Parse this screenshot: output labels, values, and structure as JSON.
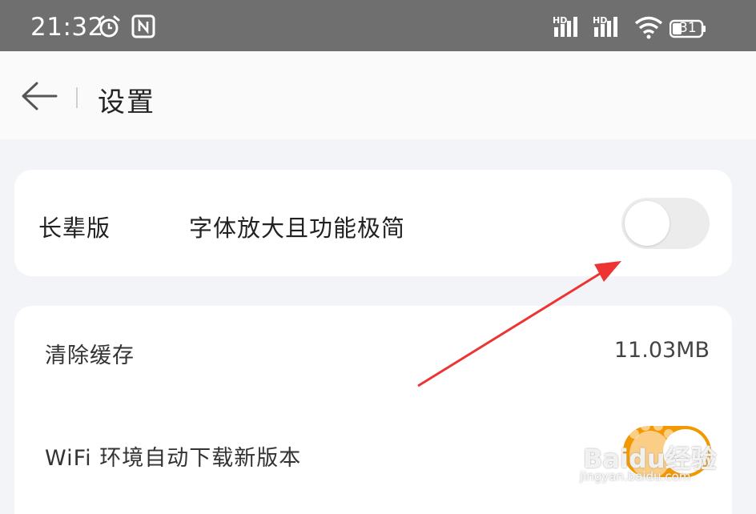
{
  "status_bar": {
    "time": "21:32",
    "battery": "31",
    "icons": [
      "alarm-icon",
      "nfc-icon",
      "hd-signal-icon",
      "hd-signal-icon",
      "wifi-icon",
      "battery-icon"
    ]
  },
  "header": {
    "title": "设置",
    "back_icon": "arrow-left-icon"
  },
  "settings": {
    "elder_mode": {
      "label": "长辈版",
      "description": "字体放大且功能极简",
      "enabled": false
    },
    "clear_cache": {
      "label": "清除缓存",
      "value": "11.03MB"
    },
    "wifi_auto_download": {
      "label": "WiFi 环境自动下载新版本",
      "enabled": true
    }
  },
  "annotation": {
    "color": "#ee3333"
  },
  "watermark": {
    "main": "Baidu经验",
    "sub": "jingyan.baidu.com"
  },
  "colors": {
    "toggle_on": "#f39800",
    "toggle_off": "#ececec"
  }
}
